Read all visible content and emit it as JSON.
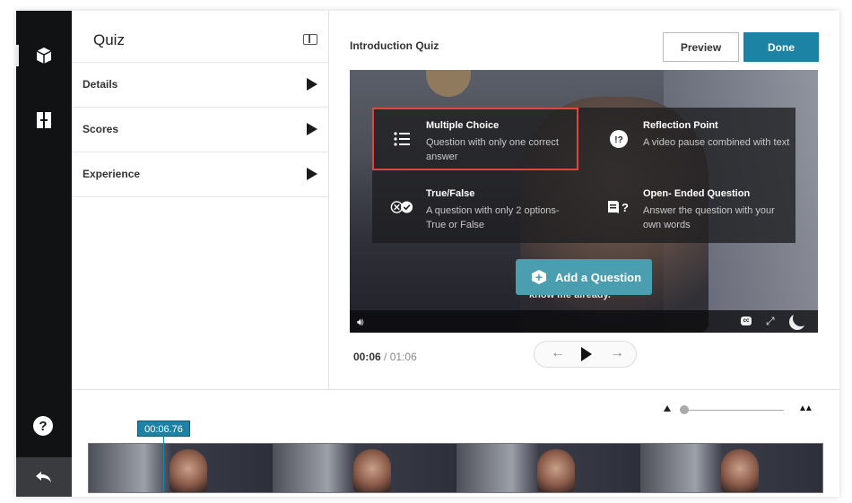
{
  "panel": {
    "title": "Quiz",
    "rows": [
      {
        "label": "Details"
      },
      {
        "label": "Scores"
      },
      {
        "label": "Experience"
      }
    ]
  },
  "main": {
    "title": "Introduction Quiz",
    "preview_label": "Preview",
    "done_label": "Done"
  },
  "question_types": [
    {
      "title": "Multiple Choice",
      "desc": "Question with only one correct answer",
      "icon": "list-icon",
      "selected": true
    },
    {
      "title": "Reflection Point",
      "desc": "A video pause combined with text",
      "icon": "question-exclaim-icon",
      "selected": false
    },
    {
      "title": "True/False",
      "desc": "A question with only 2 options- True or False",
      "icon": "true-false-icon",
      "selected": false
    },
    {
      "title": "Open- Ended Question",
      "desc": "Answer the question with your own words",
      "icon": "open-ended-icon",
      "selected": false
    }
  ],
  "add_question_label": "Add a Question",
  "caption": "know me already.",
  "player": {
    "current_time": "00:06",
    "separator": "/",
    "total_time": "01:06"
  },
  "timeline": {
    "time_tag": "00:06.76"
  },
  "colors": {
    "accent": "#1d83a5",
    "selection": "#e0453f",
    "rail": "#111214"
  }
}
